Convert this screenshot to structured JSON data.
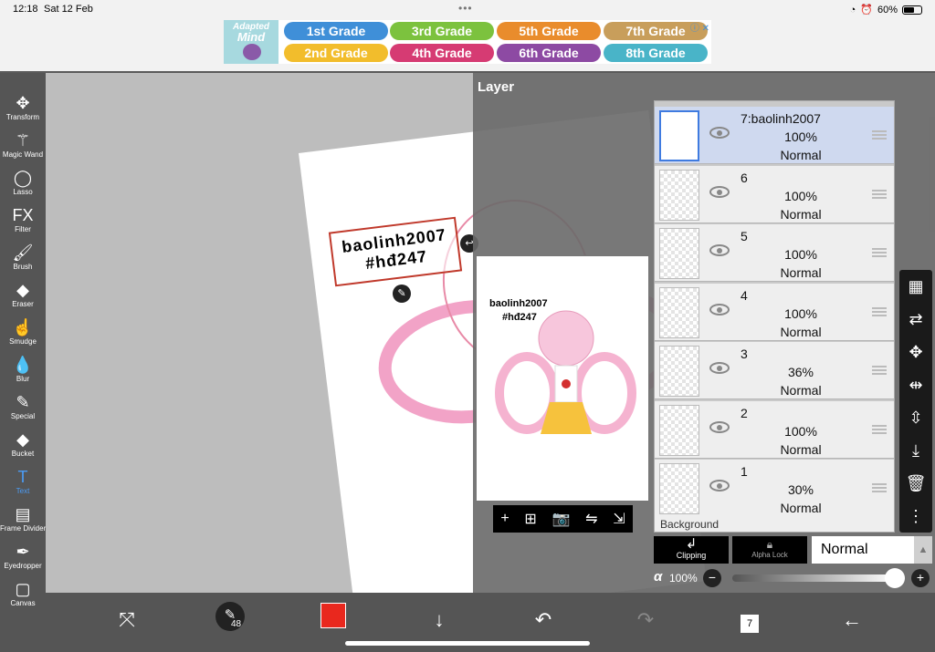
{
  "status_bar": {
    "time": "12:18",
    "date": "Sat 12 Feb",
    "battery": "60%",
    "battery_level": 0.6
  },
  "ad": {
    "logo_line1": "Adapted",
    "logo_line2": "Mind",
    "grades": [
      {
        "label": "1st Grade",
        "color": "#3f8fd8"
      },
      {
        "label": "3rd Grade",
        "color": "#7cc23e"
      },
      {
        "label": "5th Grade",
        "color": "#e98c2c"
      },
      {
        "label": "7th Grade",
        "color": "#c89e5b"
      },
      {
        "label": "2nd Grade",
        "color": "#f2bd2c"
      },
      {
        "label": "4th Grade",
        "color": "#d63b73"
      },
      {
        "label": "6th Grade",
        "color": "#8d4aa3"
      },
      {
        "label": "8th Grade",
        "color": "#49b4c8"
      }
    ],
    "close_label": "ⓘ ✕"
  },
  "toolbar": {
    "tools": [
      {
        "label": "Transform",
        "icon": "move-icon",
        "glyph": "✥"
      },
      {
        "label": "Magic Wand",
        "icon": "magic-wand-icon",
        "glyph": "⚚"
      },
      {
        "label": "Lasso",
        "icon": "lasso-icon",
        "glyph": "◯"
      },
      {
        "label": "Filter",
        "icon": "fx-icon",
        "glyph": "FX"
      },
      {
        "label": "Brush",
        "icon": "brush-icon",
        "glyph": "🖌"
      },
      {
        "label": "Eraser",
        "icon": "eraser-icon",
        "glyph": "◆"
      },
      {
        "label": "Smudge",
        "icon": "smudge-icon",
        "glyph": "☝"
      },
      {
        "label": "Blur",
        "icon": "blur-icon",
        "glyph": "💧"
      },
      {
        "label": "Special",
        "icon": "special-icon",
        "glyph": "✎"
      },
      {
        "label": "Bucket",
        "icon": "bucket-icon",
        "glyph": "◆"
      },
      {
        "label": "Text",
        "icon": "text-icon",
        "glyph": "T"
      },
      {
        "label": "Frame Divider",
        "icon": "frame-divider-icon",
        "glyph": "▤"
      },
      {
        "label": "Eyedropper",
        "icon": "eyedropper-icon",
        "glyph": "✒"
      },
      {
        "label": "Canvas",
        "icon": "canvas-icon",
        "glyph": "▢"
      }
    ],
    "active": "Text"
  },
  "canvas": {
    "text_line1": "baolinh2007",
    "text_line2": "#hđ247"
  },
  "layer_panel": {
    "title": "Layer",
    "layers": [
      {
        "name": "7:baolinh2007",
        "opacity": "100%",
        "mode": "Normal",
        "selected": true
      },
      {
        "name": "6",
        "opacity": "100%",
        "mode": "Normal",
        "selected": false
      },
      {
        "name": "5",
        "opacity": "100%",
        "mode": "Normal",
        "selected": false
      },
      {
        "name": "4",
        "opacity": "100%",
        "mode": "Normal",
        "selected": false
      },
      {
        "name": "3",
        "opacity": "36%",
        "mode": "Normal",
        "selected": false
      },
      {
        "name": "2",
        "opacity": "100%",
        "mode": "Normal",
        "selected": false
      },
      {
        "name": "1",
        "opacity": "30%",
        "mode": "Normal",
        "selected": false
      }
    ],
    "background_label": "Background",
    "preview_text_line1": "baolinh2007",
    "preview_text_line2": "#hđ247",
    "preview_tools": [
      "+",
      "⊞",
      "📷",
      "⇋",
      "⇲"
    ],
    "clipping_label": "Clipping",
    "alpha_lock_label": "Alpha Lock",
    "blend_mode": "Normal",
    "alpha_symbol": "α",
    "alpha_value": "100%",
    "alpha_level": 1.0
  },
  "right_tools": [
    {
      "icon": "checker-icon",
      "glyph": "▦"
    },
    {
      "icon": "swap-layer-icon",
      "glyph": "⇄"
    },
    {
      "icon": "move-icon",
      "glyph": "✥"
    },
    {
      "icon": "flip-horizontal-icon",
      "glyph": "⇹"
    },
    {
      "icon": "flip-vertical-icon",
      "glyph": "⇳"
    },
    {
      "icon": "merge-down-icon",
      "glyph": "⤓"
    },
    {
      "icon": "trash-icon",
      "glyph": "🗑"
    },
    {
      "icon": "more-icon",
      "glyph": "⋮"
    }
  ],
  "bottom_bar": {
    "brush_size": "48",
    "color": "#e9281e",
    "layer_count": "7"
  }
}
